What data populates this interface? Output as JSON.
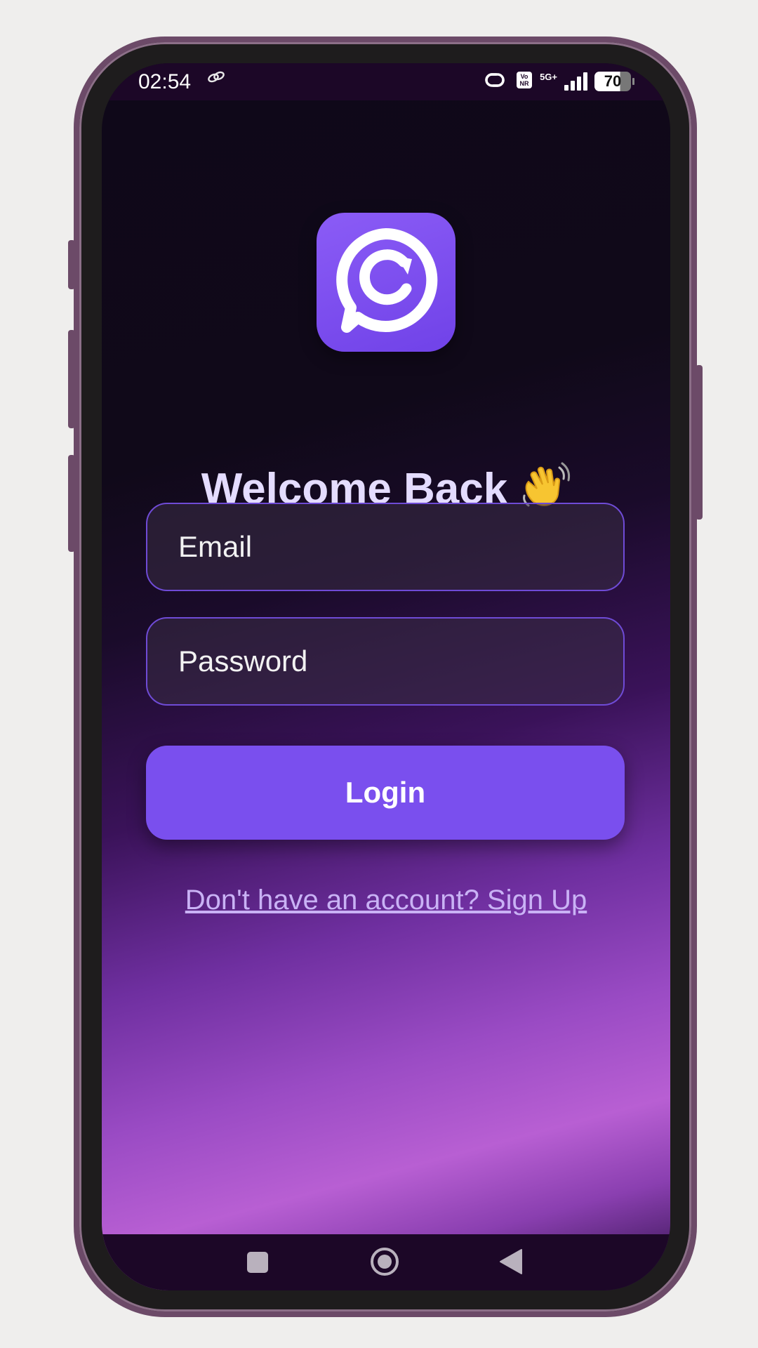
{
  "status_bar": {
    "time": "02:54",
    "network_label": "5G+",
    "volte_label": "Vo NR",
    "battery": "70",
    "icons": [
      "link-icon",
      "hotspot-icon",
      "volte-icon",
      "signal-icon",
      "battery-icon"
    ]
  },
  "app": {
    "logo_icon": "chat-refresh-icon",
    "logo_color": "#7a4fee",
    "title": "Welcome Back",
    "title_emoji": "waving-hand-icon",
    "email_placeholder": "Email",
    "password_placeholder": "Password",
    "login_label": "Login",
    "signup_link": "Don't have an account? Sign Up"
  },
  "nav_bar": {
    "icons": [
      "recents-square-icon",
      "home-circle-icon",
      "back-triangle-icon"
    ]
  }
}
